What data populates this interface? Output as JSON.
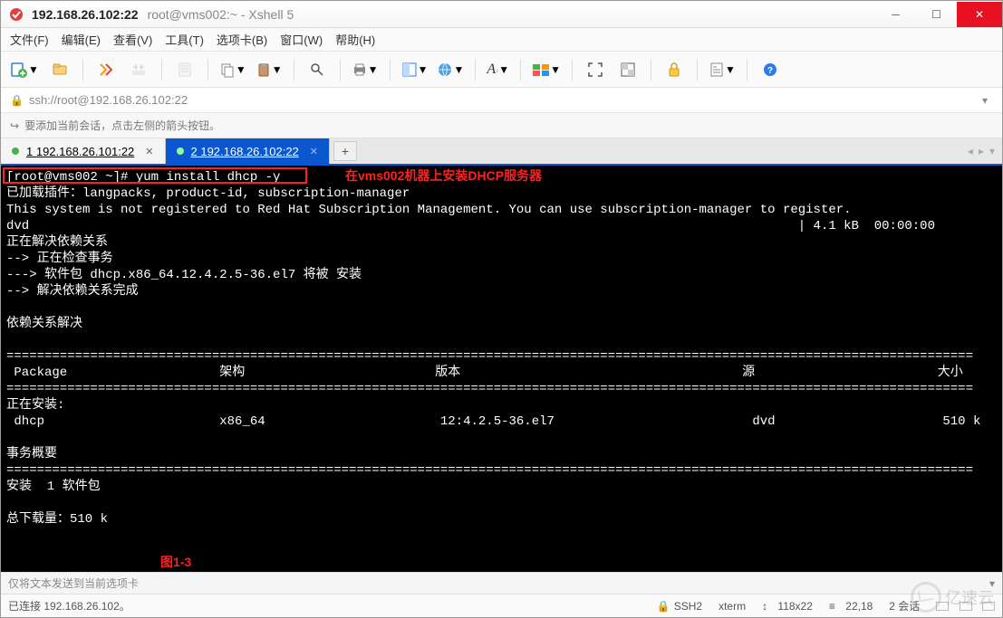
{
  "titlebar": {
    "title_bold": "192.168.26.102:22",
    "title_sub": "root@vms002:~ - Xshell 5"
  },
  "menubar": {
    "file": "文件(F)",
    "edit": "编辑(E)",
    "view": "查看(V)",
    "tools": "工具(T)",
    "tabs": "选项卡(B)",
    "window": "窗口(W)",
    "help": "帮助(H)"
  },
  "addressbar": {
    "url": "ssh://root@192.168.26.102:22"
  },
  "hintbar": {
    "text": "要添加当前会话，点击左侧的箭头按钮。"
  },
  "tabs": [
    {
      "label": "1 192.168.26.101:22",
      "active": false
    },
    {
      "label": "2 192.168.26.102:22",
      "active": true
    }
  ],
  "terminal": {
    "prompt": "[root@vms002 ~]# ",
    "cmd": "yum install dhcp -y",
    "annotation1": "在vms002机器上安装DHCP服务器",
    "annotation2": "图1-3",
    "lines_block1": "已加载插件：langpacks, product-id, subscription-manager\nThis system is not registered to Red Hat Subscription Management. You can use subscription-manager to register.\ndvd                                                                                                     | 4.1 kB  00:00:00\n正在解决依赖关系\n--> 正在检查事务\n---> 软件包 dhcp.x86_64.12.4.2.5-36.el7 将被 安装\n--> 解决依赖关系完成\n\n依赖关系解决\n",
    "table_header": " Package                    架构                         版本                                     源                        大小",
    "table_install_label": "正在安装:",
    "table_row": " dhcp                       x86_64                       12:4.2.5-36.el7                          dvd                      510 k",
    "lines_block2": "\n事务概要",
    "lines_block3": "安装  1 软件包\n\n总下载量：510 k",
    "hr": "===============================================================================================================================",
    "hr2": "==============================================================================================================================="
  },
  "footer1": {
    "text": "仅将文本发送到当前选项卡"
  },
  "footer2": {
    "status": "已连接 192.168.26.102。",
    "proto": "SSH2",
    "term": "xterm",
    "size": "118x22",
    "cursor": "22,18",
    "sessions": "2 会话"
  },
  "watermark": {
    "text": "亿速云"
  }
}
